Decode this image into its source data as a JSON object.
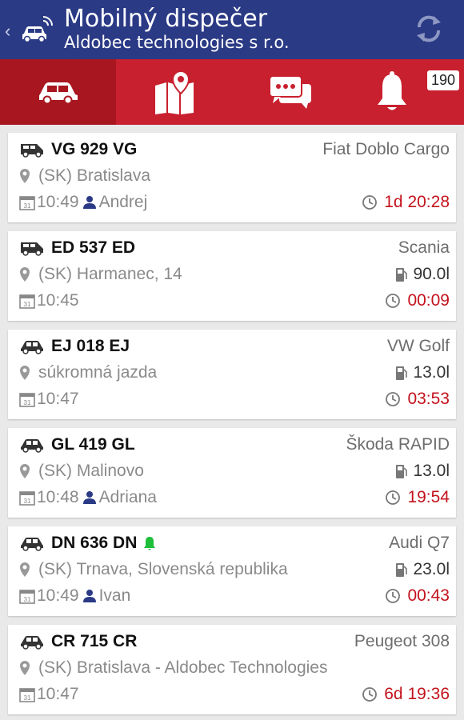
{
  "header": {
    "title": "Mobilný dispečer",
    "subtitle": "Aldobec technologies s r.o.",
    "back_icon": "chevron-left-icon",
    "app_icon": "car-signal-icon",
    "refresh_icon": "refresh-icon"
  },
  "tabs": [
    {
      "icon": "car-icon",
      "active": true
    },
    {
      "icon": "map-icon",
      "active": false
    },
    {
      "icon": "chat-icon",
      "active": false
    },
    {
      "icon": "bell-icon",
      "active": false,
      "badge": "190"
    }
  ],
  "colors": {
    "appbar": "#2a3a85",
    "tabbar": "#c8202f",
    "active_tab": "#a8161f",
    "duration": "#c4121c",
    "driver_icon": "#2a3a85",
    "alert_bell": "#1fbf3a"
  },
  "vehicles": [
    {
      "type": "van",
      "plate": "VG 929 VG",
      "model": "Fiat Doblo Cargo",
      "location": "(SK) Bratislava",
      "time": "10:49",
      "driver": "Andrej",
      "fuel": "",
      "duration": "1d 20:28",
      "alert": false
    },
    {
      "type": "van",
      "plate": "ED 537 ED",
      "model": "Scania",
      "location": "(SK) Harmanec, 14",
      "time": "10:45",
      "driver": "",
      "fuel": "90.0l",
      "duration": "00:09",
      "alert": false
    },
    {
      "type": "car",
      "plate": "EJ 018 EJ",
      "model": "VW Golf",
      "location": "súkromná jazda",
      "time": "10:47",
      "driver": "",
      "fuel": "13.0l",
      "duration": "03:53",
      "alert": false
    },
    {
      "type": "car",
      "plate": "GL 419 GL",
      "model": "Škoda RAPID",
      "location": "(SK) Malinovo",
      "time": "10:48",
      "driver": "Adriana",
      "fuel": "13.0l",
      "duration": "19:54",
      "alert": false
    },
    {
      "type": "car",
      "plate": "DN 636 DN",
      "model": "Audi Q7",
      "location": "(SK) Trnava, Slovenská republika",
      "time": "10:49",
      "driver": "Ivan",
      "fuel": "23.0l",
      "duration": "00:43",
      "alert": true
    },
    {
      "type": "car",
      "plate": "CR 715 CR",
      "model": "Peugeot 308",
      "location": "(SK) Bratislava - Aldobec Technologies",
      "time": "10:47",
      "driver": "",
      "fuel": "",
      "duration": "6d 19:36",
      "alert": false
    }
  ]
}
